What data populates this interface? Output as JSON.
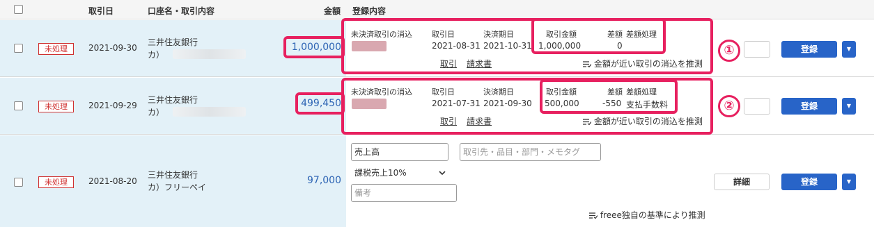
{
  "header": {
    "date": "取引日",
    "account": "口座名・取引内容",
    "amount": "金額",
    "registration": "登録内容"
  },
  "rows": [
    {
      "status": "未処理",
      "date": "2021-09-30",
      "bank_line1": "三井住友銀行",
      "bank_line2": "カ）",
      "amount": "1,000,000",
      "circle": "①",
      "match": {
        "label_unsettled": "未決済取引の消込",
        "label_date": "取引日",
        "label_due": "決済期日",
        "label_amount": "取引金額",
        "label_diff": "差額",
        "label_diff_process": "差額処理",
        "date": "2021-08-31",
        "due": "2021-10-31",
        "amount": "1,000,000",
        "diff": "0",
        "diff_process": "",
        "link_txn": "取引",
        "link_invoice": "請求書",
        "suggest": "金額が近い取引の消込を推測"
      },
      "box_text": "",
      "register": "登録"
    },
    {
      "status": "未処理",
      "date": "2021-09-29",
      "bank_line1": "三井住友銀行",
      "bank_line2": "カ）",
      "amount": "499,450",
      "circle": "②",
      "match": {
        "label_unsettled": "未決済取引の消込",
        "label_date": "取引日",
        "label_due": "決済期日",
        "label_amount": "取引金額",
        "label_diff": "差額",
        "label_diff_process": "差額処理",
        "date": "2021-07-31",
        "due": "2021-09-30",
        "amount": "500,000",
        "diff": "-550",
        "diff_process": "支払手数料",
        "link_txn": "取引",
        "link_invoice": "請求書",
        "suggest": "金額が近い取引の消込を推測"
      },
      "box_text": "",
      "register": "登録"
    },
    {
      "status": "未処理",
      "date": "2021-08-20",
      "bank_line1": "三井住友銀行",
      "bank_line2": "カ）フリーペイ",
      "amount": "97,000",
      "form": {
        "account_value": "売上高",
        "partner_placeholder": "取引先・品目・部門・メモタグ",
        "tax_value": "課税売上10%",
        "memo_placeholder": "備考",
        "suggest": "freee独自の基準により推測"
      },
      "detail": "詳細",
      "register": "登録"
    }
  ],
  "colors": {
    "highlight": "#e7205f",
    "primary": "#2864c8",
    "amount_text": "#2d64b4",
    "row_bg": "#e3f1f8",
    "status": "#d03030"
  }
}
